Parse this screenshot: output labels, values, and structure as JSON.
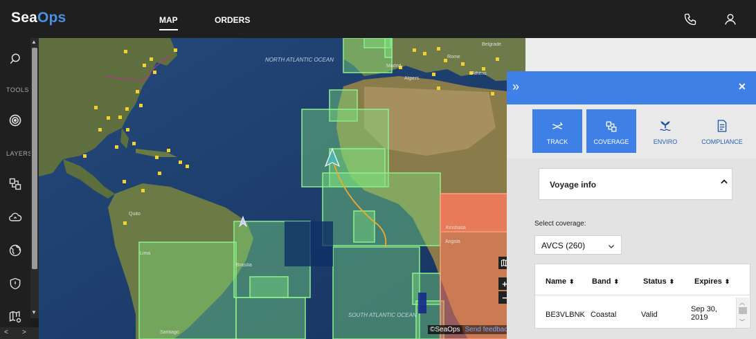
{
  "app": {
    "logo_part1": "Sea",
    "logo_part2": "Ops",
    "nav": [
      {
        "label": "MAP",
        "active": true
      },
      {
        "label": "ORDERS",
        "active": false
      }
    ],
    "icons": [
      "phone-icon",
      "user-icon"
    ]
  },
  "sidebar": {
    "tools_label": "TOOLS",
    "layers_label": "LAYERS",
    "icons": [
      "search-icon",
      "target-icon",
      "layers-icon",
      "cloud-icon",
      "globe-icon",
      "shield-icon",
      "map-settings-icon"
    ]
  },
  "map": {
    "ocean_labels": [
      "NORTH ATLANTIC OCEAN",
      "SOUTH ATLANTIC OCEAN"
    ],
    "cities": [
      "Madrid",
      "Algiers",
      "Belgrade",
      "Rome",
      "Athens",
      "Quito",
      "Lima",
      "Brasilia",
      "Santiago",
      "Kinshasa",
      "Angola"
    ],
    "controls": {
      "zoom_in": "+",
      "zoom_out": "−"
    },
    "footer_copyright": "©SeaOps",
    "footer_feedback": "Send feedback",
    "colors": {
      "coverage_green": "#7ee07e",
      "coverage_red": "#ff7a5c",
      "route": "#f0a830",
      "port": "#f2d22e"
    }
  },
  "panel": {
    "expand_glyph": "»",
    "close_glyph": "✕",
    "accent_color": "#3f80e6",
    "tabs": [
      {
        "label": "TRACK",
        "active": true
      },
      {
        "label": "COVERAGE",
        "active": true
      },
      {
        "label": "ENVIRO",
        "active": false
      },
      {
        "label": "COMPLIANCE",
        "active": false
      }
    ],
    "voyage_info_title": "Voyage info",
    "select_coverage_label": "Select coverage:",
    "select_value": "AVCS (260)",
    "table": {
      "columns": [
        "Name",
        "Band",
        "Status",
        "Expires"
      ],
      "rows": [
        {
          "name": "BE3VLBNK",
          "band": "Coastal",
          "status": "Valid",
          "expires_line1": "Sep 30,",
          "expires_line2": "2019"
        }
      ]
    }
  }
}
